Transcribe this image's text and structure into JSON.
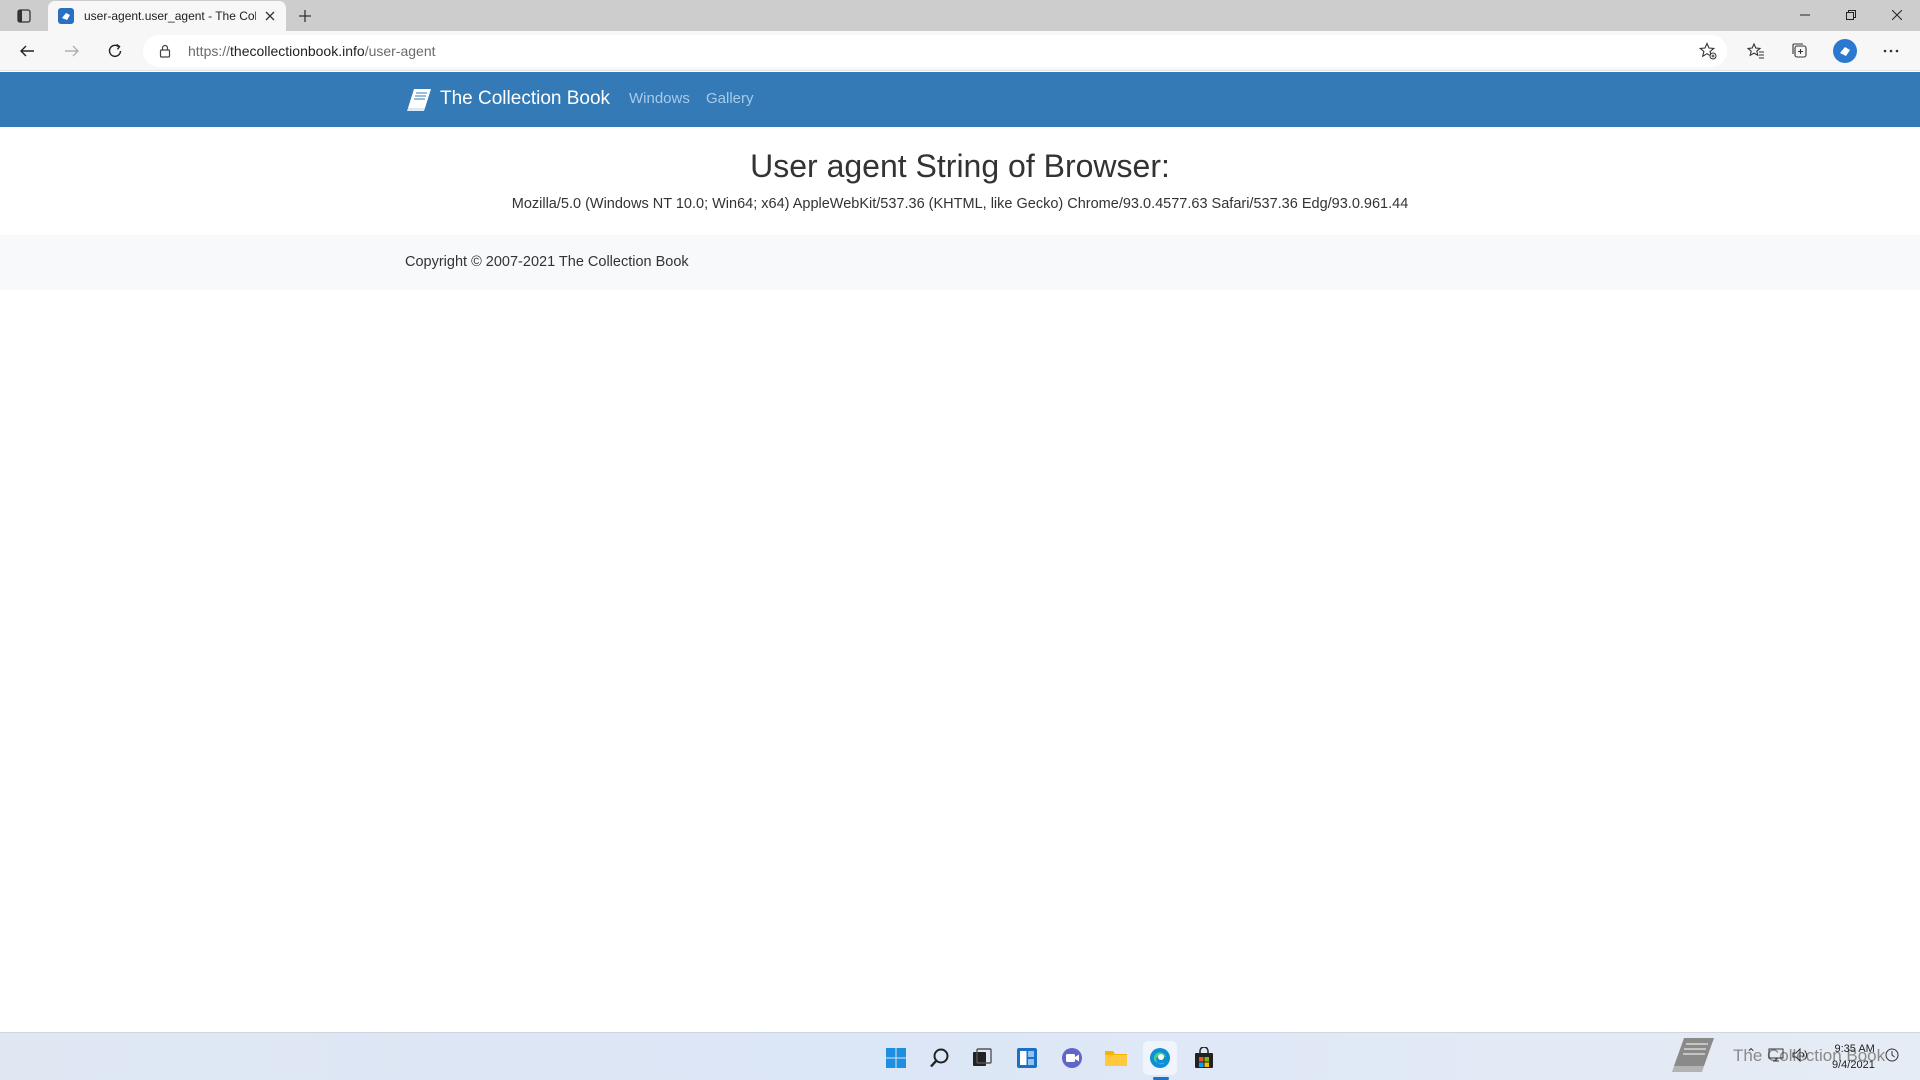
{
  "browser": {
    "tab": {
      "title": "user-agent.user_agent - The Coll"
    },
    "address_bar": {
      "url_prefix": "https://",
      "url_host": "thecollectionbook.info",
      "url_path": "/user-agent"
    }
  },
  "site": {
    "brand": "The Collection Book",
    "nav": [
      {
        "label": "Windows"
      },
      {
        "label": "Gallery"
      }
    ],
    "heading": "User agent String of Browser:",
    "user_agent": "Mozilla/5.0 (Windows NT 10.0; Win64; x64) AppleWebKit/537.36 (KHTML, like Gecko) Chrome/93.0.4577.63 Safari/537.36 Edg/93.0.961.44",
    "footer": {
      "copyright": "Copyright © 2007-2021 The Collection Book"
    }
  },
  "taskbar": {
    "icons": [
      "start-icon",
      "search-icon",
      "task-view-icon",
      "widgets-icon",
      "chat-icon",
      "file-explorer-icon",
      "edge-icon",
      "store-icon"
    ],
    "watermark": "The Collection Book",
    "clock": {
      "time": "9:35 AM",
      "date": "9/4/2021"
    }
  },
  "colors": {
    "navbar": "#337ab7",
    "nav_link": "#a8cbe9",
    "footer_bg": "#f8f9fa",
    "tabstrip": "#cdcdcd",
    "toolbar": "#f7f7f7"
  }
}
